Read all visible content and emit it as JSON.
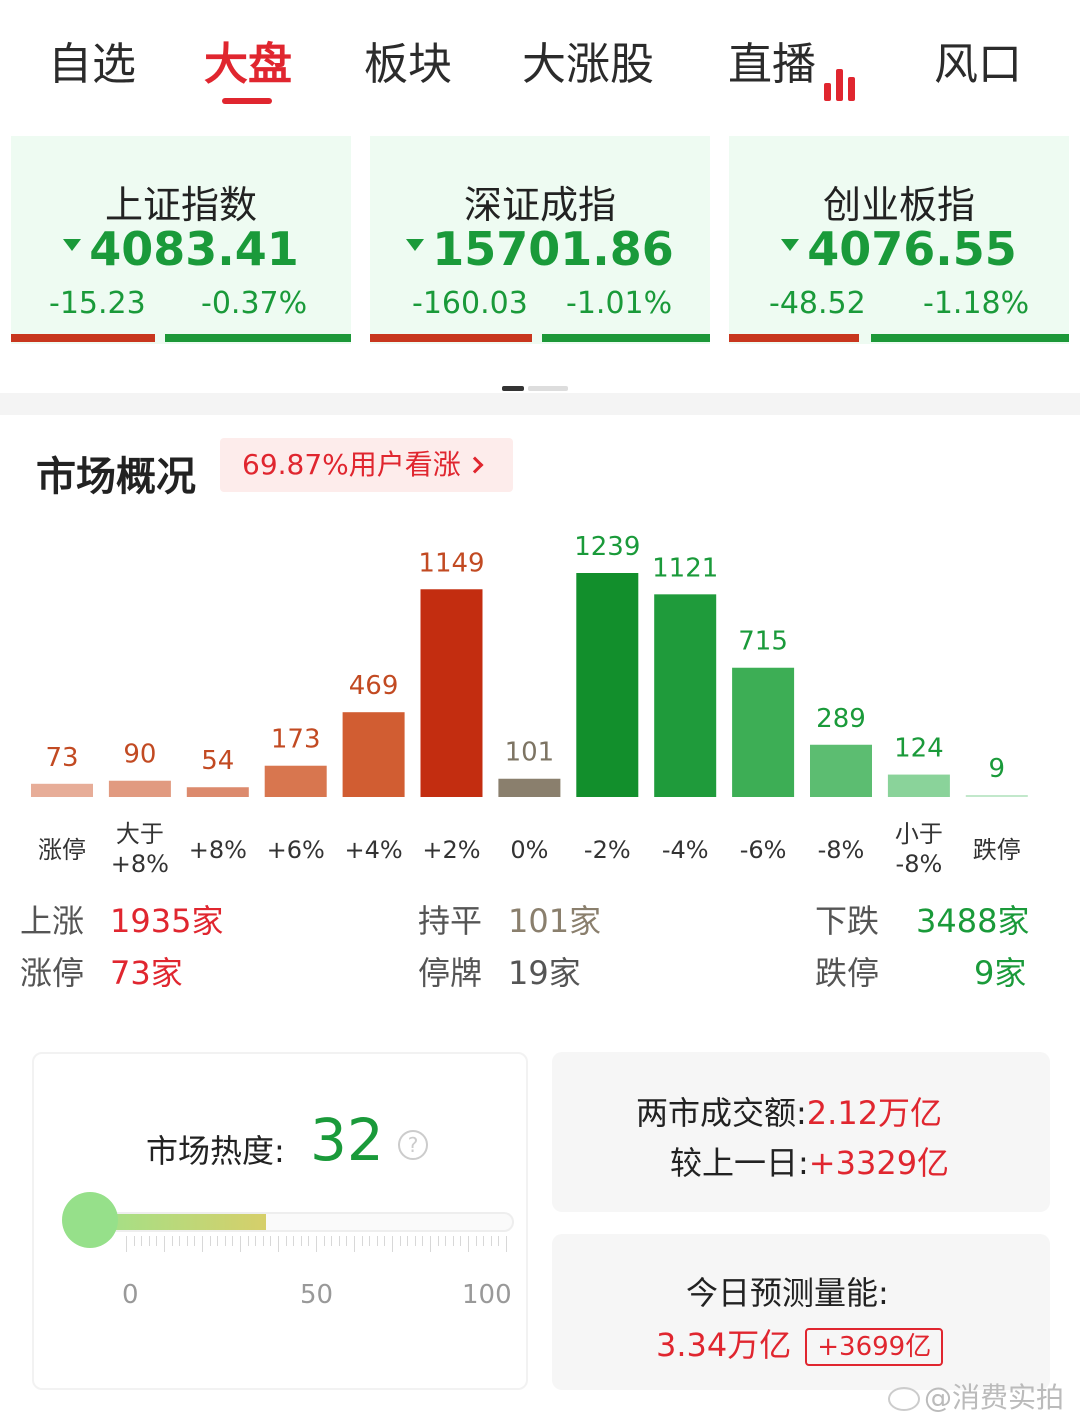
{
  "tabs": [
    {
      "label": "自选"
    },
    {
      "label": "大盘"
    },
    {
      "label": "板块"
    },
    {
      "label": "大涨股"
    },
    {
      "label": "直播"
    },
    {
      "label": "风口"
    }
  ],
  "active_tab": "大盘",
  "indices": [
    {
      "name": "上证指数",
      "value": "4083.41",
      "change": "-15.23",
      "pct": "-0.37%"
    },
    {
      "name": "深证成指",
      "value": "15701.86",
      "change": "-160.03",
      "pct": "-1.01%"
    },
    {
      "name": "创业板指",
      "value": "4076.55",
      "change": "-48.52",
      "pct": "-1.18%"
    }
  ],
  "overview": {
    "title": "市场概况",
    "sentiment": "69.87%用户看涨"
  },
  "chart_data": {
    "type": "bar",
    "categories": [
      "涨停",
      "大于+8%",
      "+8%",
      "+6%",
      "+4%",
      "+2%",
      "0%",
      "-2%",
      "-4%",
      "-6%",
      "-8%",
      "小于-8%",
      "跌停"
    ],
    "category_lines": [
      [
        "涨停"
      ],
      [
        "大于",
        "+8%"
      ],
      [
        "+8%"
      ],
      [
        "+6%"
      ],
      [
        "+4%"
      ],
      [
        "+2%"
      ],
      [
        "0%"
      ],
      [
        "-2%"
      ],
      [
        "-4%"
      ],
      [
        "-6%"
      ],
      [
        "-8%"
      ],
      [
        "小于",
        "-8%"
      ],
      [
        "跌停"
      ]
    ],
    "values": [
      73,
      90,
      54,
      173,
      469,
      1149,
      101,
      1239,
      1121,
      715,
      289,
      124,
      9
    ],
    "colors": [
      "#e7ad98",
      "#e19a80",
      "#dc8a6d",
      "#d8764f",
      "#d15d32",
      "#c32d10",
      "#8a7f6d",
      "#128f2c",
      "#1f9b3b",
      "#3dae55",
      "#5cbd71",
      "#8ad39a",
      "#c2e8cb"
    ],
    "label_colors": [
      "#c24a22",
      "#c24a22",
      "#c24a22",
      "#c24a22",
      "#c24a22",
      "#c24a22",
      "#7d7463",
      "#1a9a3a",
      "#1a9a3a",
      "#1a9a3a",
      "#1a9a3a",
      "#1a9a3a",
      "#1a9a3a"
    ],
    "ylim": [
      0,
      1239
    ]
  },
  "stats": {
    "up_label": "上涨",
    "up_value": "1935家",
    "flat_label": "持平",
    "flat_value": "101家",
    "down_label": "下跌",
    "down_value": "3488家",
    "limit_up_label": "涨停",
    "limit_up_value": "73家",
    "suspended_label": "停牌",
    "suspended_value": "19家",
    "limit_down_label": "跌停",
    "limit_down_value": "9家"
  },
  "heat": {
    "label": "市场热度:",
    "value": "32",
    "level": 0.32,
    "help": "?",
    "axis": [
      "0",
      "50",
      "100"
    ]
  },
  "turnover": {
    "label": "两市成交额:",
    "value": "2.12万亿",
    "compare_label": "较上一日:",
    "compare_value": "+3329亿"
  },
  "forecast": {
    "label": "今日预测量能:",
    "value": "3.34万亿",
    "delta": "+3699亿"
  },
  "watermark": "@消费实拍",
  "colors": {
    "red": "#e0262f",
    "green": "#1a9a3a",
    "card_bg": "#eefbf2"
  }
}
